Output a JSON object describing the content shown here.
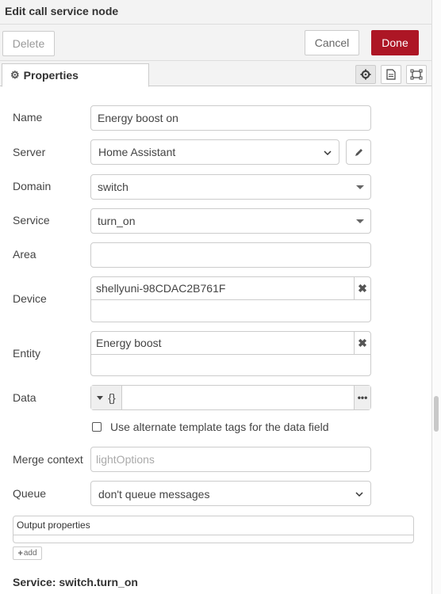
{
  "dialog": {
    "title": "Edit call service node",
    "delete_label": "Delete",
    "cancel_label": "Cancel",
    "done_label": "Done",
    "accent": "#ad1625"
  },
  "tabs": {
    "properties_label": "Properties",
    "icons": [
      "gear-icon",
      "description-icon",
      "appearance-icon"
    ]
  },
  "form": {
    "name": {
      "label": "Name",
      "value": "Energy boost on"
    },
    "server": {
      "label": "Server",
      "value": "Home Assistant"
    },
    "domain": {
      "label": "Domain",
      "value": "switch"
    },
    "service": {
      "label": "Service",
      "value": "turn_on"
    },
    "area": {
      "label": "Area",
      "value": ""
    },
    "device": {
      "label": "Device",
      "value": "shellyuni-98CDAC2B761F"
    },
    "entity": {
      "label": "Entity",
      "value": "Energy boost"
    },
    "data": {
      "label": "Data",
      "type_symbol": "{}",
      "value": ""
    },
    "alt_tags": {
      "label": "Use alternate template tags for the data field",
      "checked": false
    },
    "merge_context": {
      "label": "Merge context",
      "placeholder": "lightOptions"
    },
    "queue": {
      "label": "Queue",
      "value": "don't queue messages"
    }
  },
  "output": {
    "header": "Output properties",
    "add_label": "add"
  },
  "service_summary": "Service: switch.turn_on"
}
